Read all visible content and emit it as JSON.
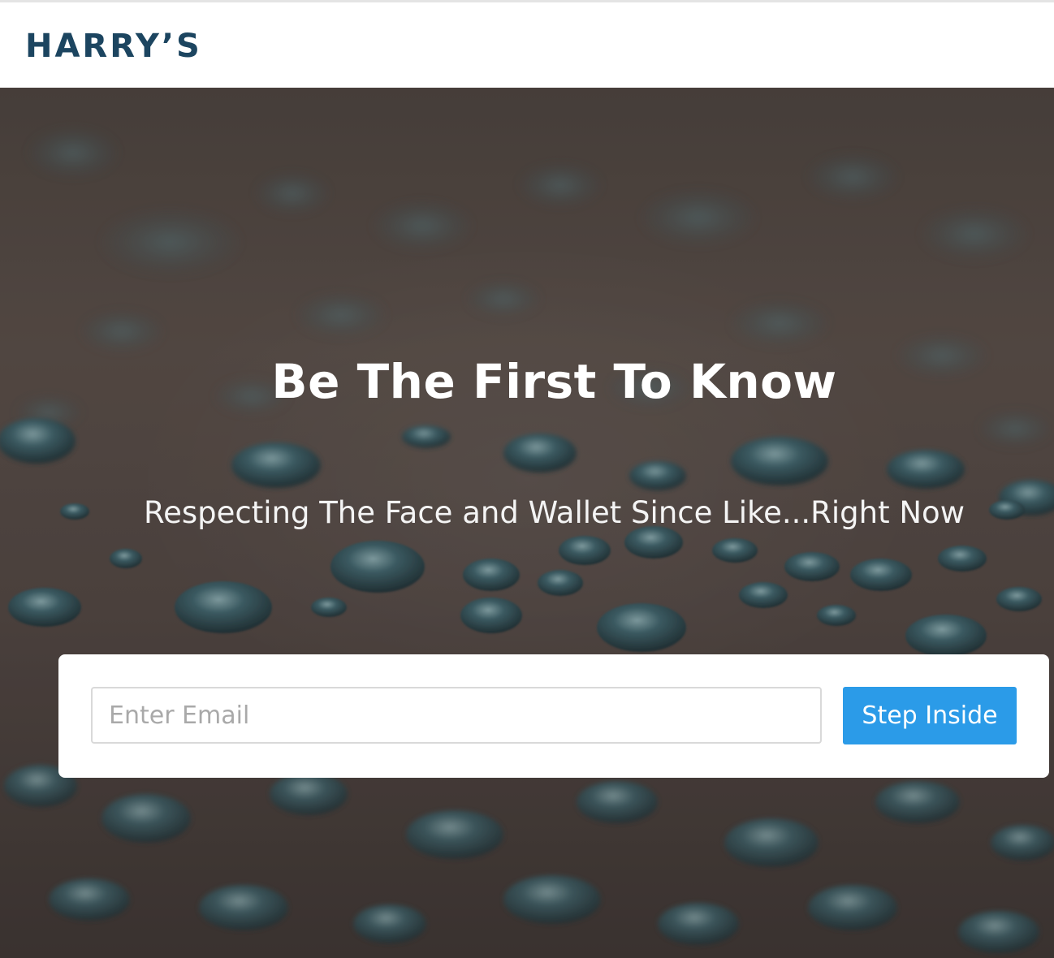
{
  "brand": {
    "logo_text": "HARRY’S"
  },
  "hero": {
    "headline": "Be The First To Know",
    "subheadline": "Respecting The Face and Wallet Since Like...Right Now"
  },
  "signup": {
    "email_placeholder": "Enter Email",
    "email_value": "",
    "submit_label": "Step Inside"
  },
  "colors": {
    "brand_navy": "#1c4560",
    "button_blue": "#2b9be8",
    "background_overlay": "#4d4440",
    "drop_teal": "#3a5a64"
  }
}
